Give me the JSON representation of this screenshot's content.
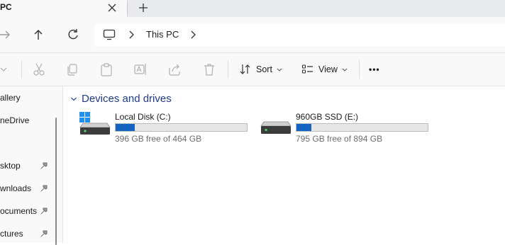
{
  "tab": {
    "title": "PC",
    "close_icon": "close-icon",
    "new_tab_icon": "plus-icon"
  },
  "address": {
    "location_icon": "computer-icon",
    "crumb": "This PC"
  },
  "toolbar": {
    "sort_label": "Sort",
    "view_label": "View",
    "more_label": "•••"
  },
  "sidebar": {
    "items": [
      {
        "label": "allery",
        "pinned": false
      },
      {
        "label": "neDrive",
        "pinned": false
      },
      {
        "label": "sktop",
        "pinned": true
      },
      {
        "label": "wnloads",
        "pinned": true
      },
      {
        "label": "ocuments",
        "pinned": true
      },
      {
        "label": "ctures",
        "pinned": true
      }
    ]
  },
  "main": {
    "section_title": "Devices and drives",
    "drives": [
      {
        "name": "Local Disk (C:)",
        "free_text": "396 GB free of 464 GB",
        "used_fraction": 0.147,
        "os_drive": true
      },
      {
        "name": "960GB SSD (E:)",
        "free_text": "795 GB free of 894 GB",
        "used_fraction": 0.111,
        "os_drive": false
      }
    ]
  },
  "colors": {
    "accent": "#1565c0",
    "section_title": "#1f3a8a",
    "chrome": "#f9f9fa"
  }
}
